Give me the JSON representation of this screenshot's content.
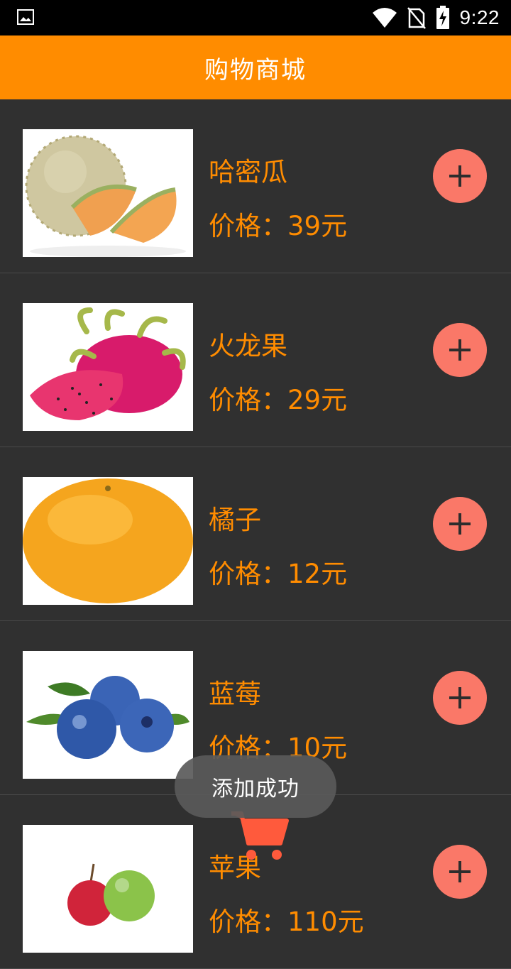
{
  "status_bar": {
    "time": "9:22",
    "icons": [
      "gallery-icon",
      "wifi-icon",
      "no-sim-icon",
      "battery-charging-icon"
    ]
  },
  "app_bar": {
    "title": "购物商城"
  },
  "products": [
    {
      "name": "哈密瓜",
      "price": "价格：39元",
      "image": "cantaloupe-image",
      "add_icon": "plus-icon"
    },
    {
      "name": "火龙果",
      "price": "价格：29元",
      "image": "dragon-fruit-image",
      "add_icon": "plus-icon"
    },
    {
      "name": "橘子",
      "price": "价格：12元",
      "image": "orange-image",
      "add_icon": "plus-icon"
    },
    {
      "name": "蓝莓",
      "price": "价格：10元",
      "image": "blueberry-image",
      "add_icon": "plus-icon"
    },
    {
      "name": "苹果",
      "price": "价格：110元",
      "image": "apple-image",
      "add_icon": "plus-icon"
    }
  ],
  "toast": {
    "text": "添加成功"
  },
  "colors": {
    "accent": "#FF8C00",
    "background": "#303030",
    "add_button": "#FA7868",
    "divider": "#4A4A4A",
    "toast_bg": "#5A5A5A"
  }
}
